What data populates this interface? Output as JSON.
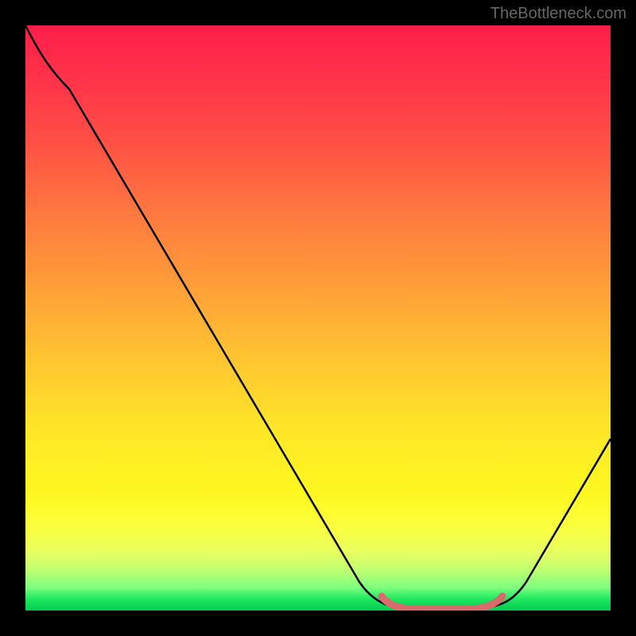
{
  "watermark": "TheBottleneck.com",
  "chart_data": {
    "type": "line",
    "title": "",
    "xlabel": "",
    "ylabel": "",
    "xlim": [
      0,
      100
    ],
    "ylim": [
      0,
      100
    ],
    "series": [
      {
        "name": "bottleneck-curve",
        "x": [
          0,
          5,
          10,
          20,
          30,
          40,
          50,
          58,
          62,
          66,
          72,
          78,
          82,
          88,
          94,
          100
        ],
        "y": [
          100,
          94,
          90,
          76,
          62,
          48,
          34,
          20,
          10,
          3,
          0,
          0,
          1,
          6,
          16,
          30
        ],
        "color": "#000000"
      },
      {
        "name": "optimal-zone",
        "x": [
          62,
          66,
          72,
          78,
          82
        ],
        "y": [
          4,
          1,
          0,
          0,
          2
        ],
        "color": "#d86b6b"
      }
    ],
    "gradient_stops": [
      {
        "pos": 0,
        "color": "#ff1e4a"
      },
      {
        "pos": 50,
        "color": "#ffc830"
      },
      {
        "pos": 85,
        "color": "#fff820"
      },
      {
        "pos": 100,
        "color": "#00cc50"
      }
    ]
  }
}
